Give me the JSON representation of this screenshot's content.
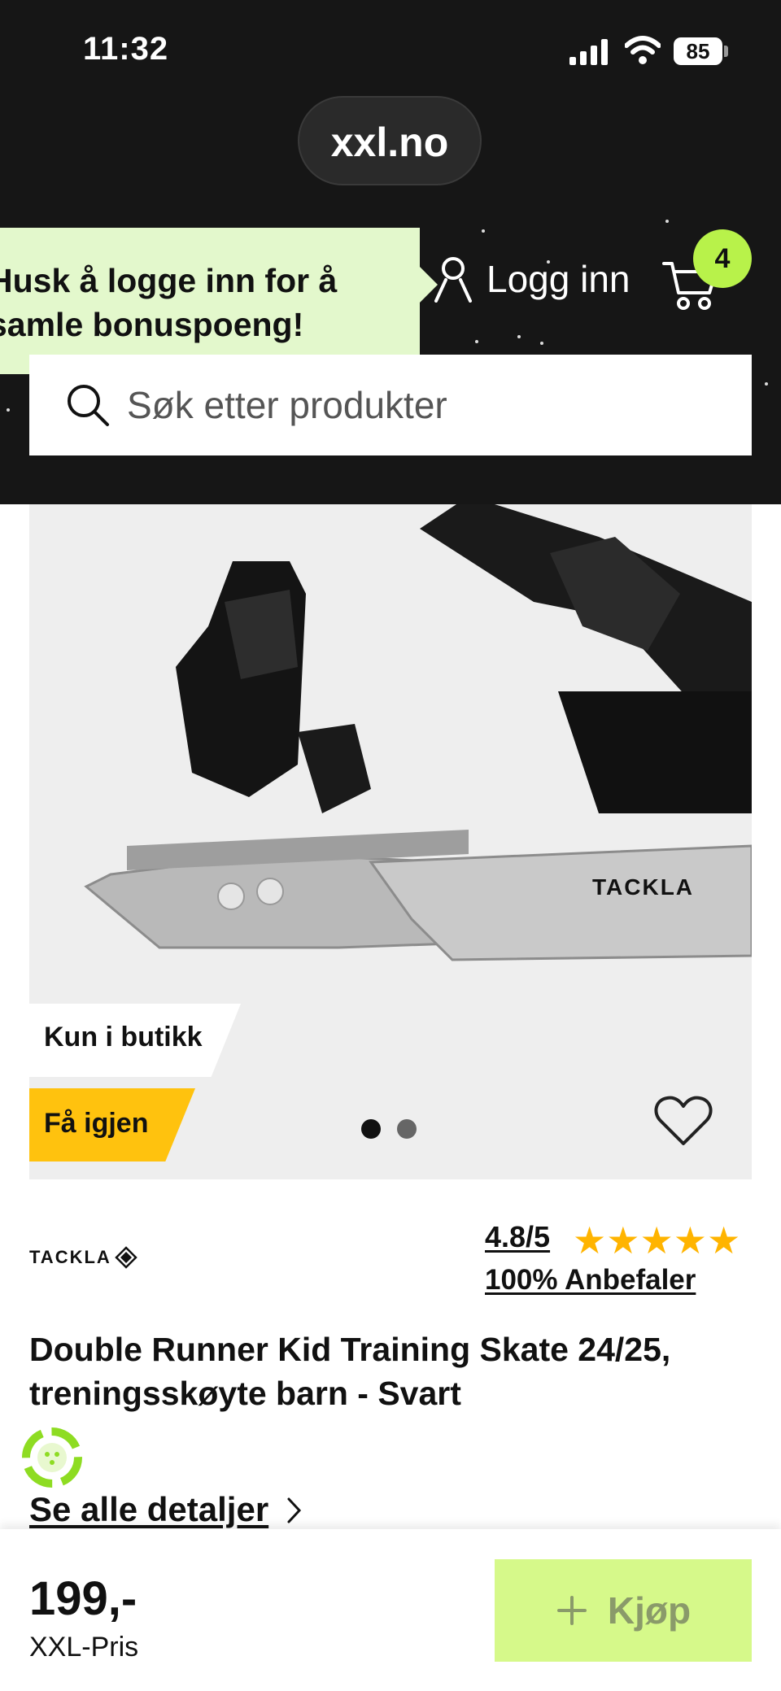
{
  "status_bar": {
    "time": "11:32",
    "battery": "85"
  },
  "browser": {
    "url": "xxl.no"
  },
  "header": {
    "promo_text": "Husk å logge inn for å\nsamle bonuspoeng!",
    "login_label": "Logg inn",
    "cart_count": "4"
  },
  "search": {
    "placeholder": "Søk etter produkter"
  },
  "product": {
    "image_brand_text": "TACKLA",
    "tags": {
      "store_only": "Kun i butikk",
      "restock": "Få igjen"
    },
    "carousel": {
      "total": 2,
      "active": 1
    },
    "brand": "TACKLA",
    "rating": "4.8/5",
    "stars": 5,
    "recommend": "100% Anbefaler",
    "title": "Double Runner Kid Training Skate 24/25, treningsskøyte barn - Svart",
    "details_link": "Se alle detaljer"
  },
  "purchase_bar": {
    "price": "199,-",
    "price_label": "XXL-Pris",
    "buy_label": "Kjøp"
  },
  "colors": {
    "header_bg": "#161616",
    "accent_green": "#b8f24a",
    "promo_bg": "#e3f8cc",
    "restock_yellow": "#ffc20e",
    "star_color": "#ffb400",
    "buy_button_bg": "#d6f98a"
  },
  "icons": [
    "signal-icon",
    "wifi-icon",
    "user-icon",
    "cart-icon",
    "search-icon",
    "heart-icon",
    "chevron-right-icon",
    "plus-icon",
    "eco-badge-icon"
  ]
}
